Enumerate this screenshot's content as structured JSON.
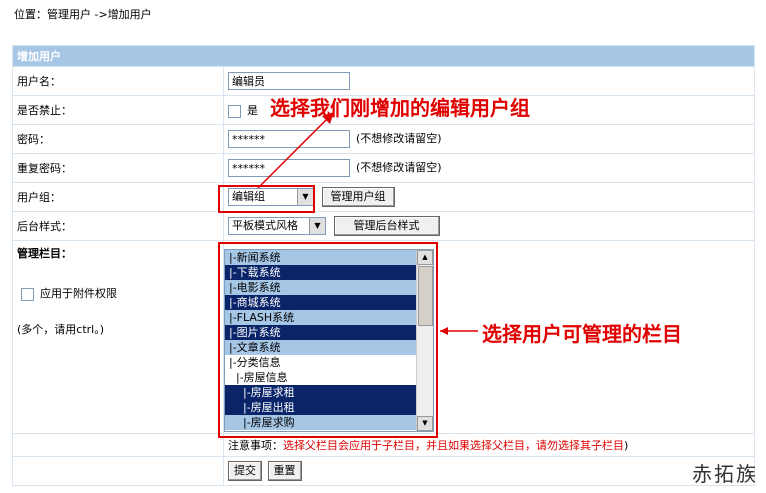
{
  "breadcrumb": {
    "prefix": "位置：",
    "link": "管理用户",
    "sep": " ->",
    "current": "增加用户"
  },
  "form": {
    "title": "增加用户",
    "username": {
      "label": "用户名：",
      "value": "编辑员"
    },
    "disabled": {
      "label": "是否禁止：",
      "option": "是"
    },
    "password": {
      "label": "密码：",
      "value": "******",
      "hint": "(不想修改请留空)"
    },
    "password2": {
      "label": "重复密码：",
      "value": "******",
      "hint": "(不想修改请留空)"
    },
    "group": {
      "label": "用户组：",
      "selected": "编辑组",
      "button": "管理用户组"
    },
    "style": {
      "label": "后台样式：",
      "selected": "平板模式风格",
      "button": "管理后台样式"
    },
    "columns": {
      "label": "管理栏目：",
      "attach": "应用于附件权限",
      "multi_hint": "(多个，请用ctrl。)",
      "options": [
        {
          "text": "|-新闻系统",
          "state": "sel1"
        },
        {
          "text": "|-下载系统",
          "state": "sel2"
        },
        {
          "text": "|-电影系统",
          "state": "sel1"
        },
        {
          "text": "|-商城系统",
          "state": "sel2"
        },
        {
          "text": "|-FLASH系统",
          "state": "sel1"
        },
        {
          "text": "|-图片系统",
          "state": "sel2"
        },
        {
          "text": "|-文章系统",
          "state": "sel1"
        },
        {
          "text": "|-分类信息",
          "state": ""
        },
        {
          "text": "  |-房屋信息",
          "state": ""
        },
        {
          "text": "    |-房屋求租",
          "state": "sel2"
        },
        {
          "text": "    |-房屋出租",
          "state": "sel2"
        },
        {
          "text": "    |-房屋求购",
          "state": "sel1"
        }
      ]
    },
    "notice": {
      "label": "注意事项：",
      "text": "选择父栏目会应用于子栏目，并且如果选择父栏目，请勿选择其子栏目",
      "close": ")"
    },
    "submit": "提交",
    "reset": "重置"
  },
  "annotations": {
    "top": "选择我们刚增加的编辑用户组",
    "right": "选择用户可管理的栏目"
  },
  "watermark": "赤拓族",
  "colors": {
    "header": "#a6c6e6",
    "selected_dark": "#0a246a",
    "annotation": "#e00000"
  }
}
